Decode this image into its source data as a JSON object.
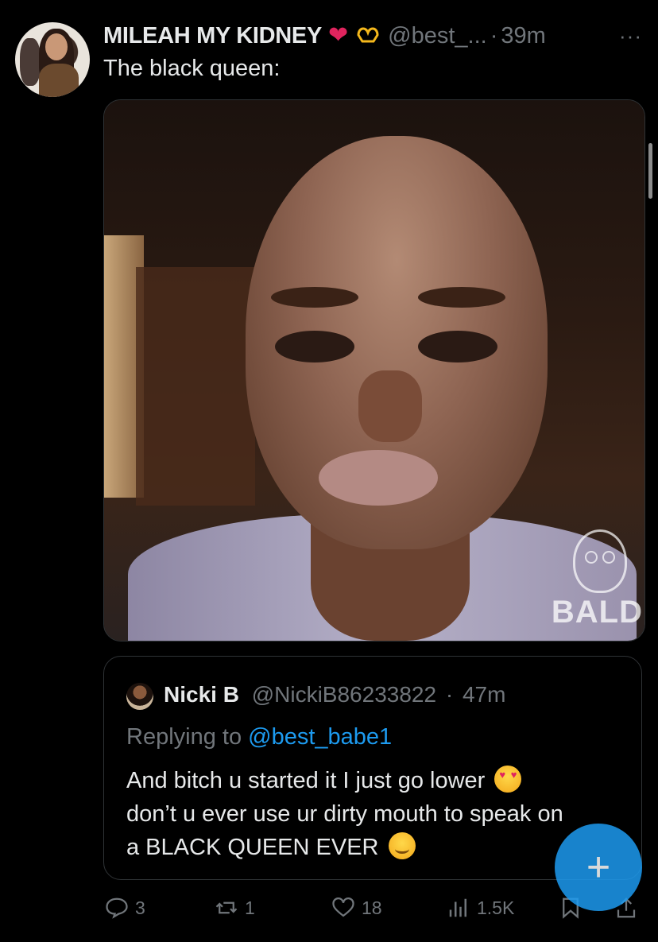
{
  "tweet": {
    "author_name": "MILEAH MY KIDNEY",
    "name_emojis": [
      "red-heart",
      "heart-hands"
    ],
    "handle": "@best_...",
    "separator": "·",
    "time": "39m",
    "more_label": "···",
    "text": "The black queen:"
  },
  "media": {
    "watermark_text": "BALD"
  },
  "quote": {
    "author_name": "Nicki B",
    "handle": "@NickiB86233822",
    "separator": "·",
    "time": "47m",
    "replying_prefix": "Replying to",
    "replying_mention": "@best_babe1",
    "text_line1": "And bitch u started it I just go lower",
    "text_line2": "don’t u ever use ur dirty mouth to speak on",
    "text_line3": "a BLACK QUEEN EVER"
  },
  "actions": {
    "reply_count": "3",
    "retweet_count": "1",
    "like_count": "18",
    "views_count": "1.5K"
  },
  "fab": {
    "label": "+"
  },
  "colors": {
    "background": "#000000",
    "text": "#e7e9ea",
    "muted": "#71767b",
    "accent": "#1d9bf0",
    "border": "#2f3336"
  }
}
